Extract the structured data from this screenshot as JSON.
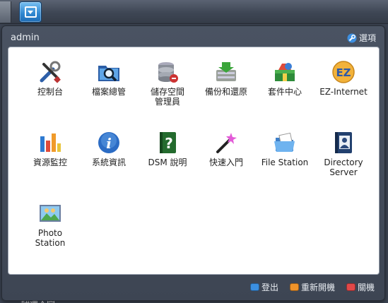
{
  "panel": {
    "user": "admin",
    "options_label": "選項"
  },
  "apps": [
    {
      "label": "控制台",
      "icon": "control-panel-icon"
    },
    {
      "label": "檔案總管",
      "icon": "file-browser-icon"
    },
    {
      "label": "儲存空間\n管理員",
      "icon": "storage-manager-icon"
    },
    {
      "label": "備份和還原",
      "icon": "backup-restore-icon"
    },
    {
      "label": "套件中心",
      "icon": "package-center-icon"
    },
    {
      "label": "EZ-Internet",
      "icon": "ez-internet-icon"
    },
    {
      "label": "資源監控",
      "icon": "resource-monitor-icon"
    },
    {
      "label": "系統資訊",
      "icon": "system-info-icon"
    },
    {
      "label": "DSM 說明",
      "icon": "dsm-help-icon"
    },
    {
      "label": "快速入門",
      "icon": "quick-start-icon"
    },
    {
      "label": "File Station",
      "icon": "file-station-icon"
    },
    {
      "label": "Directory\nServer",
      "icon": "directory-server-icon"
    },
    {
      "label": "Photo\nStation",
      "icon": "photo-station-icon"
    }
  ],
  "footer": {
    "logout": "登出",
    "restart": "重新開機",
    "shutdown": "關機"
  },
  "desktop": {
    "ghost_label": "快速入門"
  },
  "colors": {
    "logout": "#3b8fe0",
    "restart": "#f0932a",
    "shutdown": "#e24848"
  }
}
